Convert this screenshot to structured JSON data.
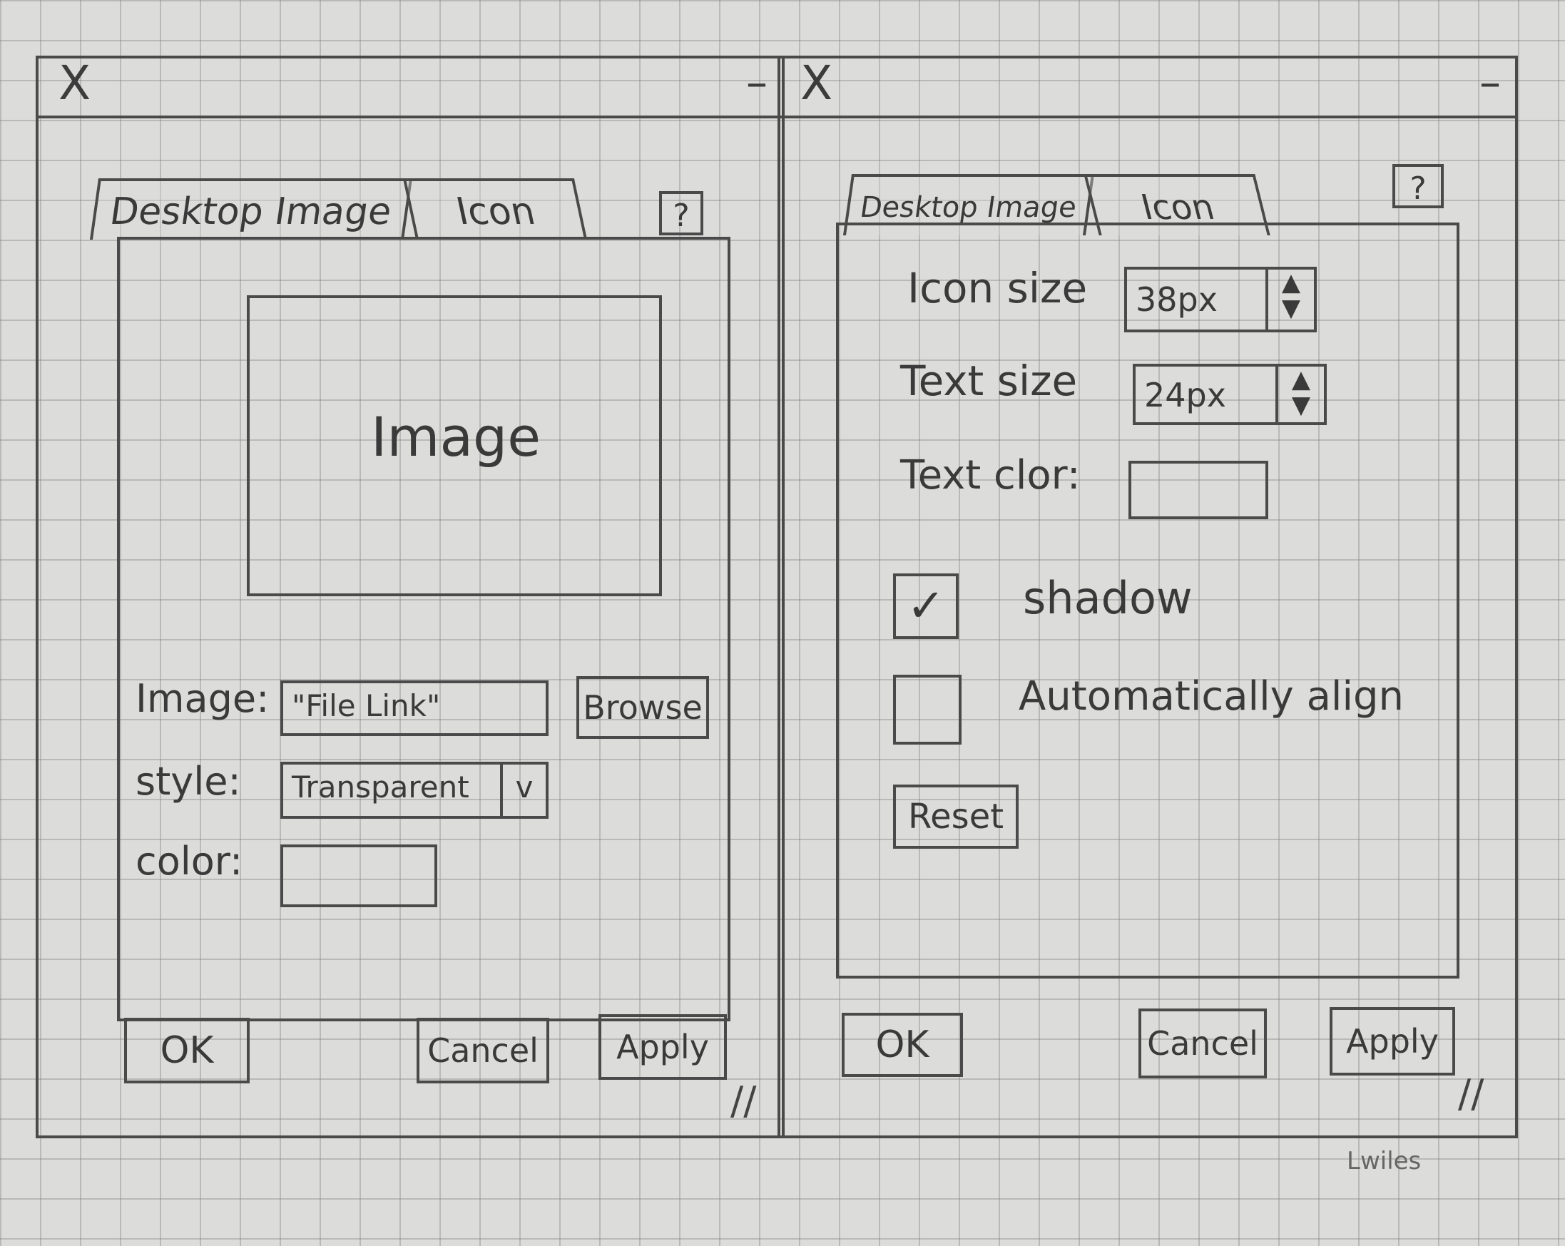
{
  "left_window": {
    "close_glyph": "X",
    "minimize_glyph": "–",
    "tabs": [
      {
        "label": "Desktop Image"
      },
      {
        "label": "Icon"
      }
    ],
    "help_glyph": "?",
    "preview_label": "Image",
    "image_label": "Image:",
    "image_field_value": "\"File Link\"",
    "browse_label": "Browse",
    "style_label": "style:",
    "style_value": "Transparent",
    "dropdown_glyph": "v",
    "color_label": "color:",
    "ok_label": "OK",
    "cancel_label": "Cancel",
    "apply_label": "Apply",
    "grip_glyph": "//"
  },
  "right_window": {
    "close_glyph": "X",
    "minimize_glyph": "–",
    "tabs": [
      {
        "label": "Desktop Image"
      },
      {
        "label": "Icon"
      }
    ],
    "help_glyph": "?",
    "icon_size_label": "Icon size",
    "icon_size_value": "38px",
    "text_size_label": "Text size",
    "text_size_value": "24px",
    "stepper_up": "▲",
    "stepper_down": "▼",
    "text_color_label": "Text clor:",
    "shadow_check_glyph": "✓",
    "shadow_label": "shadow",
    "auto_align_label": "Automatically align",
    "reset_label": "Reset",
    "ok_label": "OK",
    "cancel_label": "Cancel",
    "apply_label": "Apply",
    "grip_glyph": "//"
  },
  "signature": "Lwiles"
}
